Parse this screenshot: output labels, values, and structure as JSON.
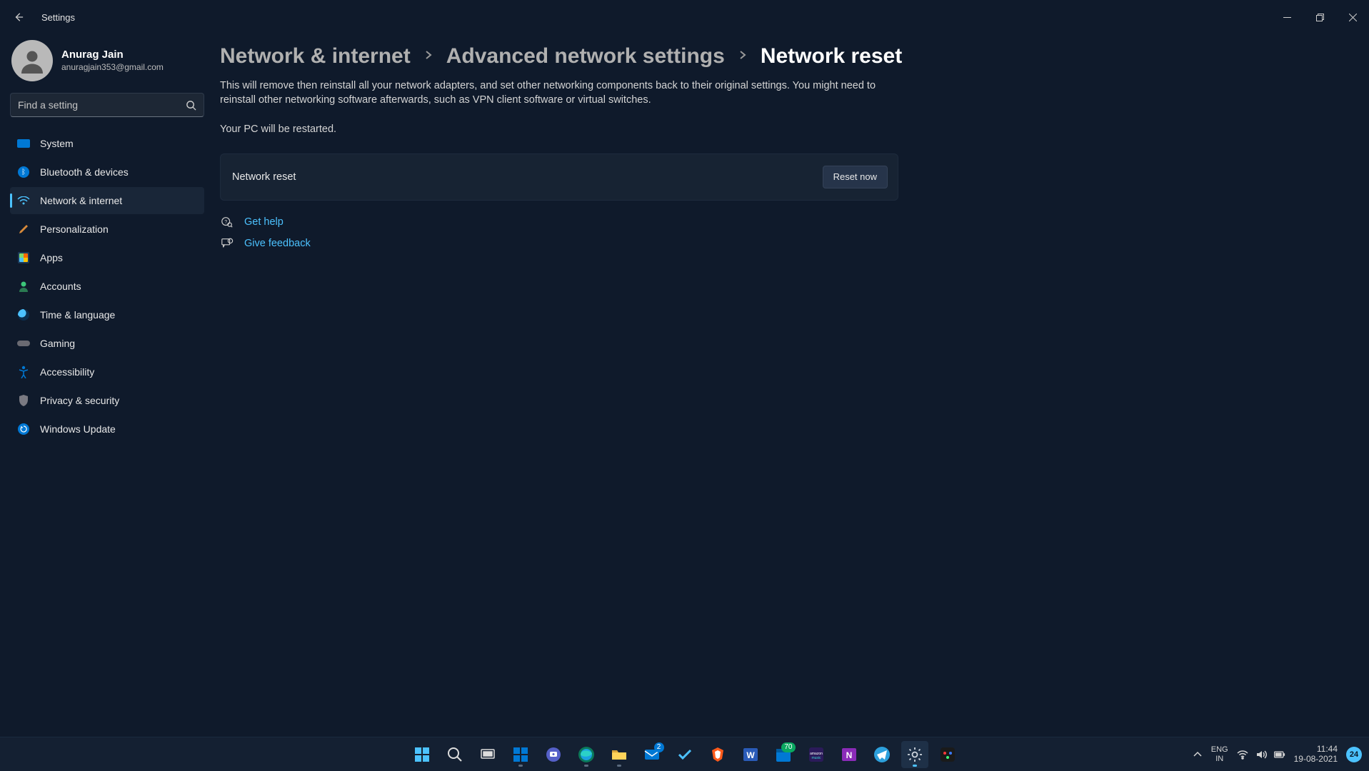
{
  "window": {
    "title": "Settings"
  },
  "user": {
    "name": "Anurag Jain",
    "email": "anuragjain353@gmail.com"
  },
  "search": {
    "placeholder": "Find a setting"
  },
  "sidebar": {
    "items": [
      {
        "label": "System",
        "icon": "system"
      },
      {
        "label": "Bluetooth & devices",
        "icon": "bluetooth"
      },
      {
        "label": "Network & internet",
        "icon": "network",
        "active": true
      },
      {
        "label": "Personalization",
        "icon": "personalization"
      },
      {
        "label": "Apps",
        "icon": "apps"
      },
      {
        "label": "Accounts",
        "icon": "accounts"
      },
      {
        "label": "Time & language",
        "icon": "time"
      },
      {
        "label": "Gaming",
        "icon": "gaming"
      },
      {
        "label": "Accessibility",
        "icon": "accessibility"
      },
      {
        "label": "Privacy & security",
        "icon": "privacy"
      },
      {
        "label": "Windows Update",
        "icon": "update"
      }
    ]
  },
  "breadcrumb": {
    "0": "Network & internet",
    "1": "Advanced network settings",
    "2": "Network reset"
  },
  "content": {
    "description": "This will remove then reinstall all your network adapters, and set other networking components back to their original settings. You might need to reinstall other networking software afterwards, such as VPN client software or virtual switches.",
    "restart_note": "Your PC will be restarted.",
    "card_title": "Network reset",
    "reset_button": "Reset now",
    "help_link": "Get help",
    "feedback_link": "Give feedback"
  },
  "taskbar": {
    "lang_top": "ENG",
    "lang_bottom": "IN",
    "time": "11:44",
    "date": "19-08-2021",
    "notifications": "24",
    "mail_badge": "2",
    "calendar_badge": "70"
  }
}
